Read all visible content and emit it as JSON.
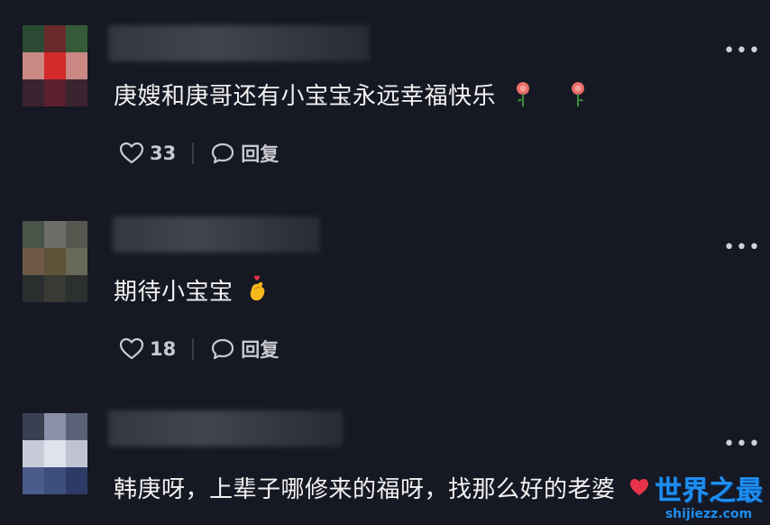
{
  "comments": [
    {
      "text": "庚嫂和庚哥还有小宝宝永远幸福快乐",
      "emoji": [
        "rose-icon",
        "rose-icon"
      ],
      "likes": "33",
      "reply_label": "回复",
      "avatar_colors": [
        "#2a4a34",
        "#6a2a2a",
        "#355a38",
        "#c98a84",
        "#d42a2a",
        "#c98884",
        "#3a2430",
        "#5a2030",
        "#3a2430"
      ]
    },
    {
      "text": "期待小宝宝",
      "emoji": [
        "finger-heart-icon"
      ],
      "likes": "18",
      "reply_label": "回复",
      "avatar_colors": [
        "#4a5448",
        "#6e6e68",
        "#565850",
        "#6e5a46",
        "#5e5238",
        "#6a6a58",
        "#2a2e2e",
        "#3a3a34",
        "#2c302e"
      ]
    },
    {
      "text": "韩庚呀，上辈子哪修来的福呀，找那么好的老婆",
      "emoji": [
        "heart-icon"
      ],
      "avatar_colors": [
        "#3a4052",
        "#8a90a8",
        "#5a6278",
        "#c8ccd8",
        "#dfe3ee",
        "#c0c4d2",
        "#4a5a8a",
        "#3e4e7a",
        "#2e3a66"
      ]
    }
  ],
  "watermark": {
    "main": "世界之最",
    "url": "shijiezz.com"
  },
  "colors": {
    "background": "#161823",
    "text": "#f2f2f2",
    "muted": "#c9cad0",
    "watermark": "#1e8ef0"
  }
}
